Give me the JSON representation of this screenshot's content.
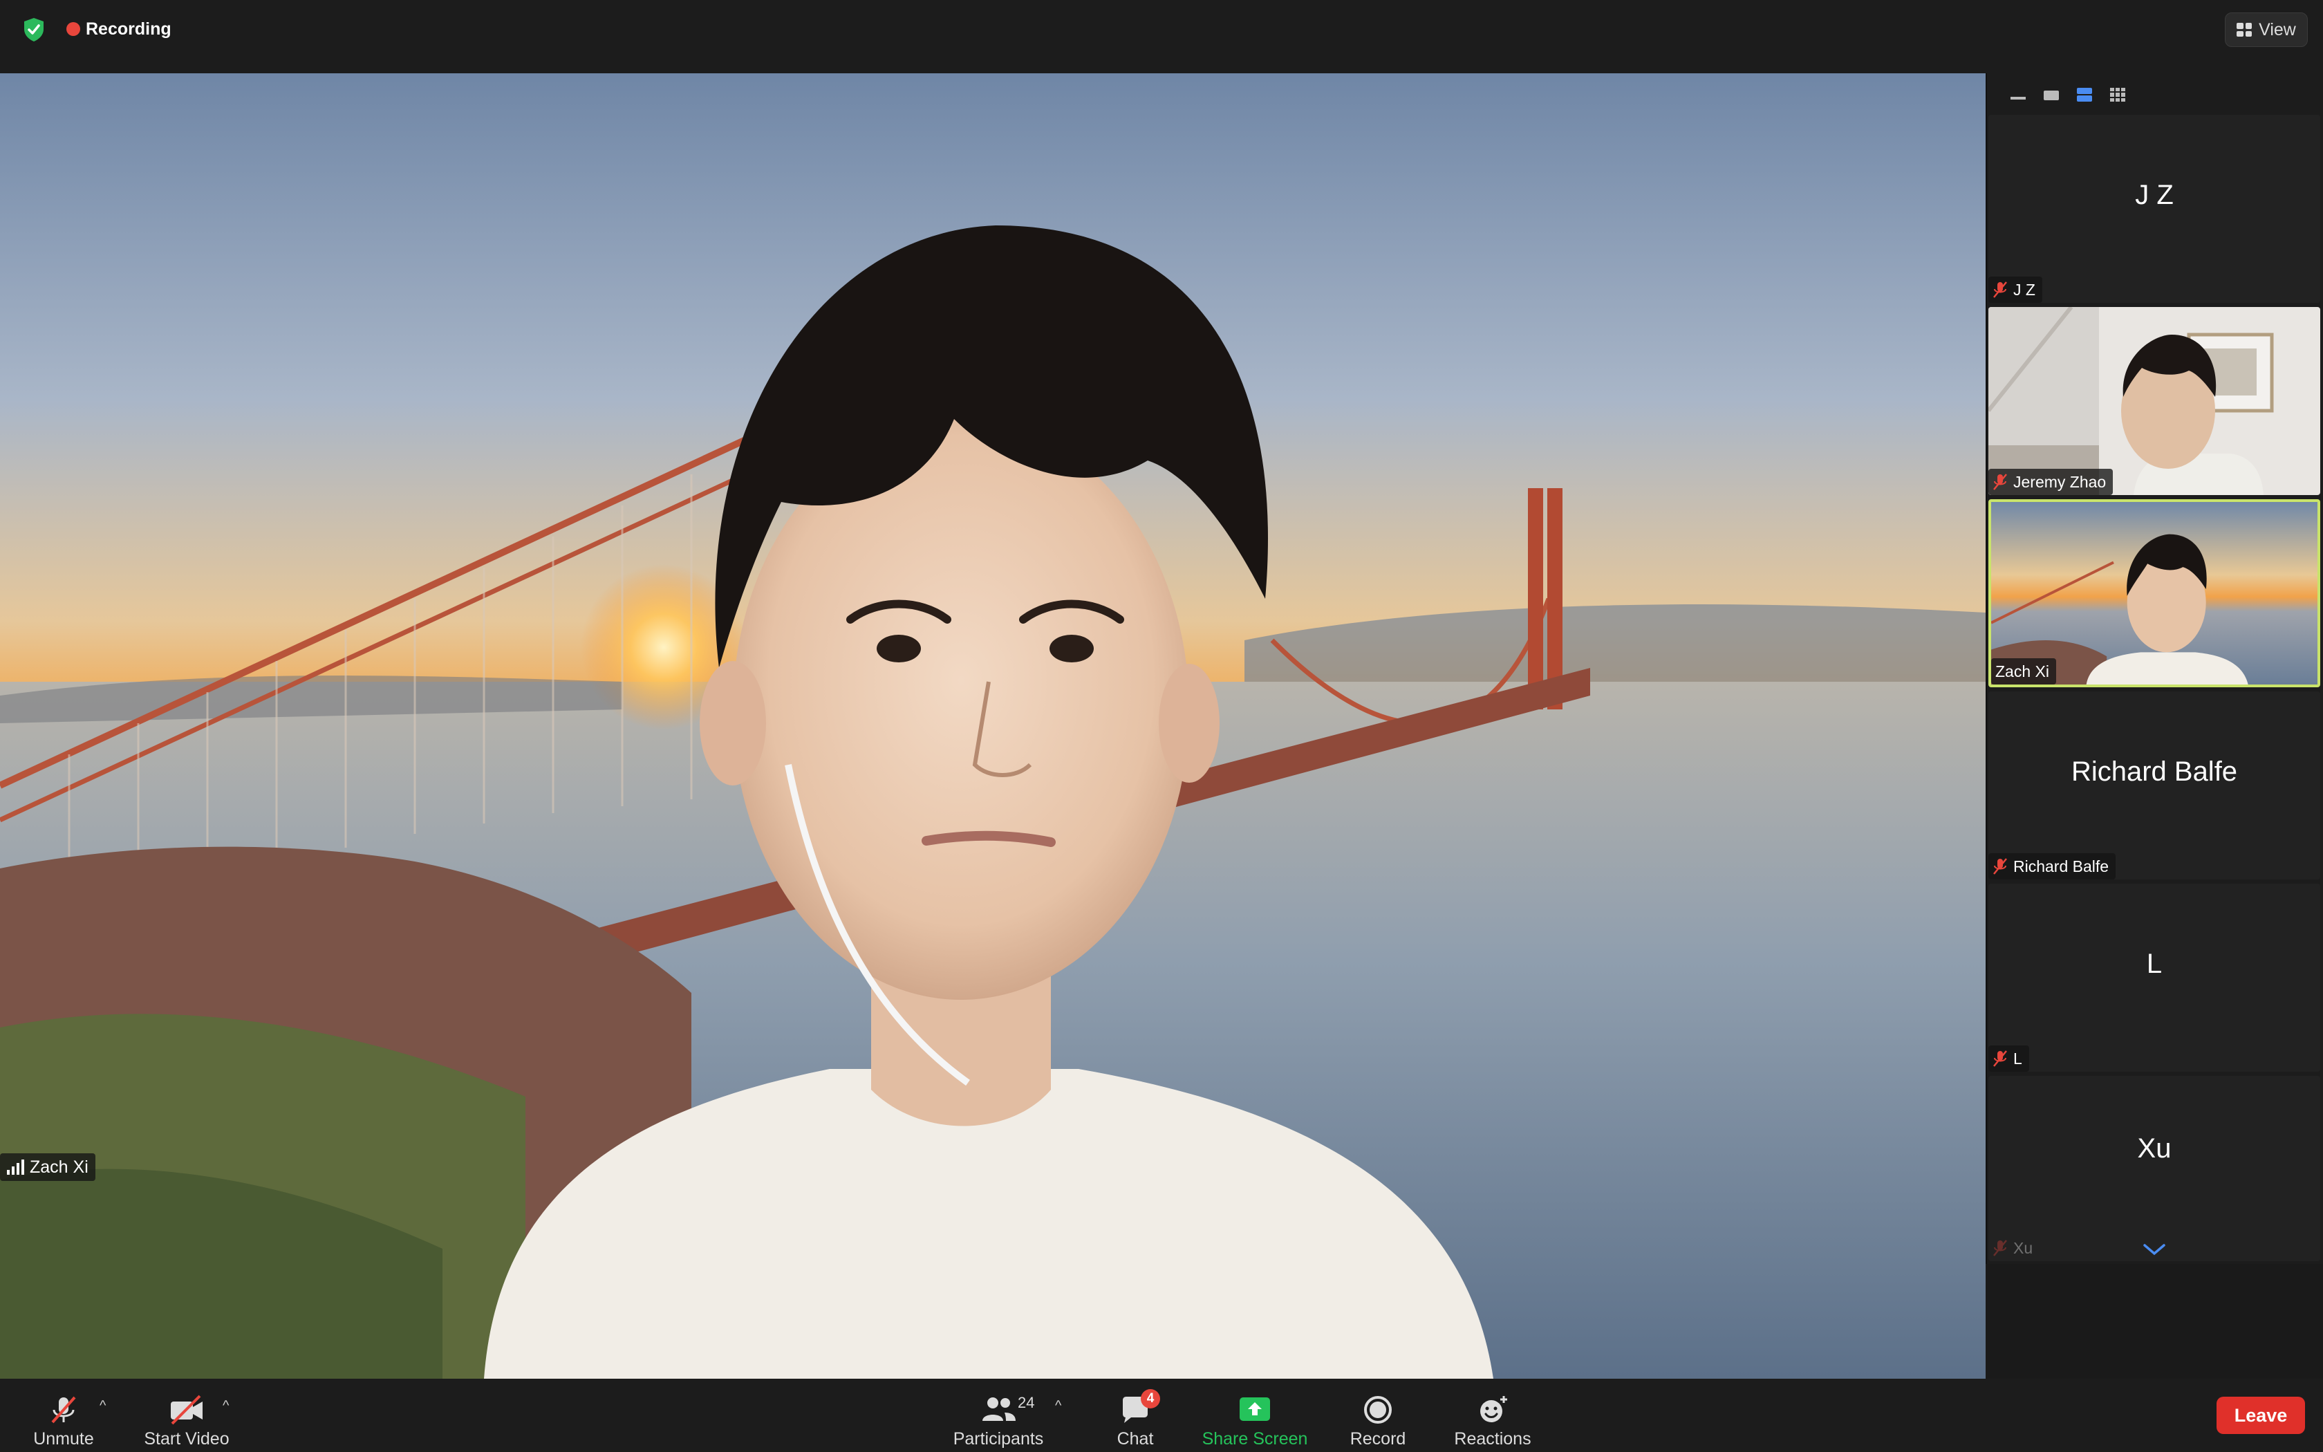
{
  "topbar": {
    "recording_label": "Recording",
    "view_label": "View"
  },
  "main_video": {
    "participant_name": "Zach Xi"
  },
  "gallery": {
    "tiles": [
      {
        "display_name": "J Z",
        "label": "J Z",
        "muted": true,
        "video": false
      },
      {
        "display_name": "",
        "label": "Jeremy Zhao",
        "muted": true,
        "video": true
      },
      {
        "display_name": "",
        "label": "Zach Xi",
        "muted": false,
        "video": true,
        "active": true
      },
      {
        "display_name": "Richard Balfe",
        "label": "Richard Balfe",
        "muted": true,
        "video": false
      },
      {
        "display_name": "L",
        "label": "L",
        "muted": true,
        "video": false
      },
      {
        "display_name": "Xu",
        "label": "Xu",
        "muted": true,
        "video": false
      }
    ]
  },
  "toolbar": {
    "unmute_label": "Unmute",
    "start_video_label": "Start Video",
    "participants_label": "Participants",
    "participants_count": "24",
    "chat_label": "Chat",
    "chat_badge": "4",
    "share_label": "Share Screen",
    "record_label": "Record",
    "reactions_label": "Reactions",
    "leave_label": "Leave"
  },
  "colors": {
    "accent_green": "#25c35b",
    "leave_red": "#e0302a",
    "active_speaker_border": "#c9e36b",
    "recording_dot": "#e8463c"
  },
  "icons": {
    "shield": "shield-check-icon",
    "recording": "record-dot-icon",
    "view": "grid-icon",
    "mic": "mic-off-icon",
    "video": "video-off-icon",
    "participants": "people-icon",
    "chat": "chat-bubble-icon",
    "share": "share-screen-icon",
    "record": "record-icon",
    "reactions": "smiley-plus-icon"
  }
}
